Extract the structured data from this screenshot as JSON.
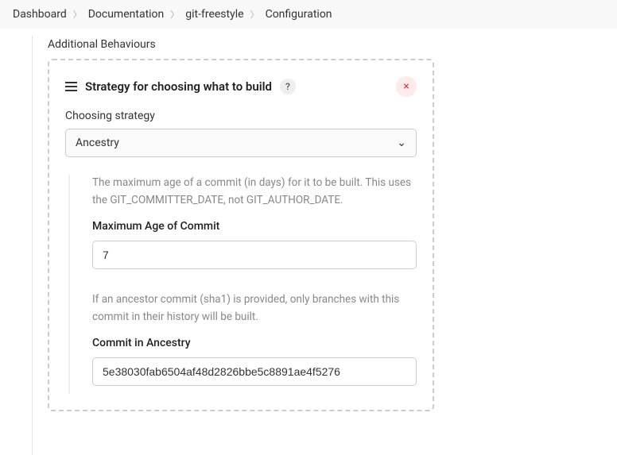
{
  "breadcrumb": {
    "items": [
      "Dashboard",
      "Documentation",
      "git-freestyle",
      "Configuration"
    ]
  },
  "behaviours": {
    "heading": "Additional Behaviours"
  },
  "section": {
    "title": "Strategy for choosing what to build",
    "help": "?",
    "close": "×",
    "choosingLabel": "Choosing strategy",
    "choosingValue": "Ancestry",
    "maxAgeDesc": "The maximum age of a commit (in days) for it to be built. This uses the GIT_COMMITTER_DATE, not GIT_AUTHOR_DATE.",
    "maxAgeLabel": "Maximum Age of Commit",
    "maxAgeValue": "7",
    "ancestryDesc": "If an ancestor commit (sha1) is provided, only branches with this commit in their history will be built.",
    "ancestryLabel": "Commit in Ancestry",
    "ancestryValue": "5e38030fab6504af48d2826bbe5c8891ae4f5276"
  }
}
